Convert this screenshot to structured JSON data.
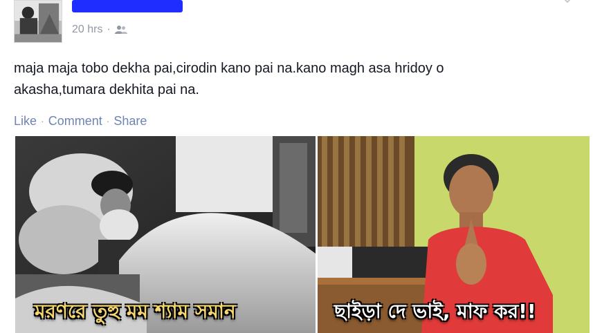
{
  "post": {
    "author": "",
    "timestamp": "20 hrs",
    "separator": "·",
    "privacy_icon": "friends-icon",
    "text_line1": "maja maja tobo dekha pai,cirodin kano pai na.kano magh asa hridoy o",
    "text_line2": "akasha,tumara dekhita pai na."
  },
  "actions": {
    "like": "Like",
    "comment": "Comment",
    "share": "Share",
    "separator": "·"
  },
  "photos": [
    {
      "caption": "মরণরে তুহু মম শ্যাম সমান",
      "style": "black-and-white"
    },
    {
      "caption": "ছাইড়া দে ভাই, মাফ কর!!",
      "style": "color"
    }
  ],
  "colors": {
    "link": "#6d84b4",
    "meta": "#9197a3",
    "text": "#141823",
    "name_scribble": "#1f2dff",
    "caption_left": "#f5d76e",
    "caption_right": "#ffffff"
  }
}
